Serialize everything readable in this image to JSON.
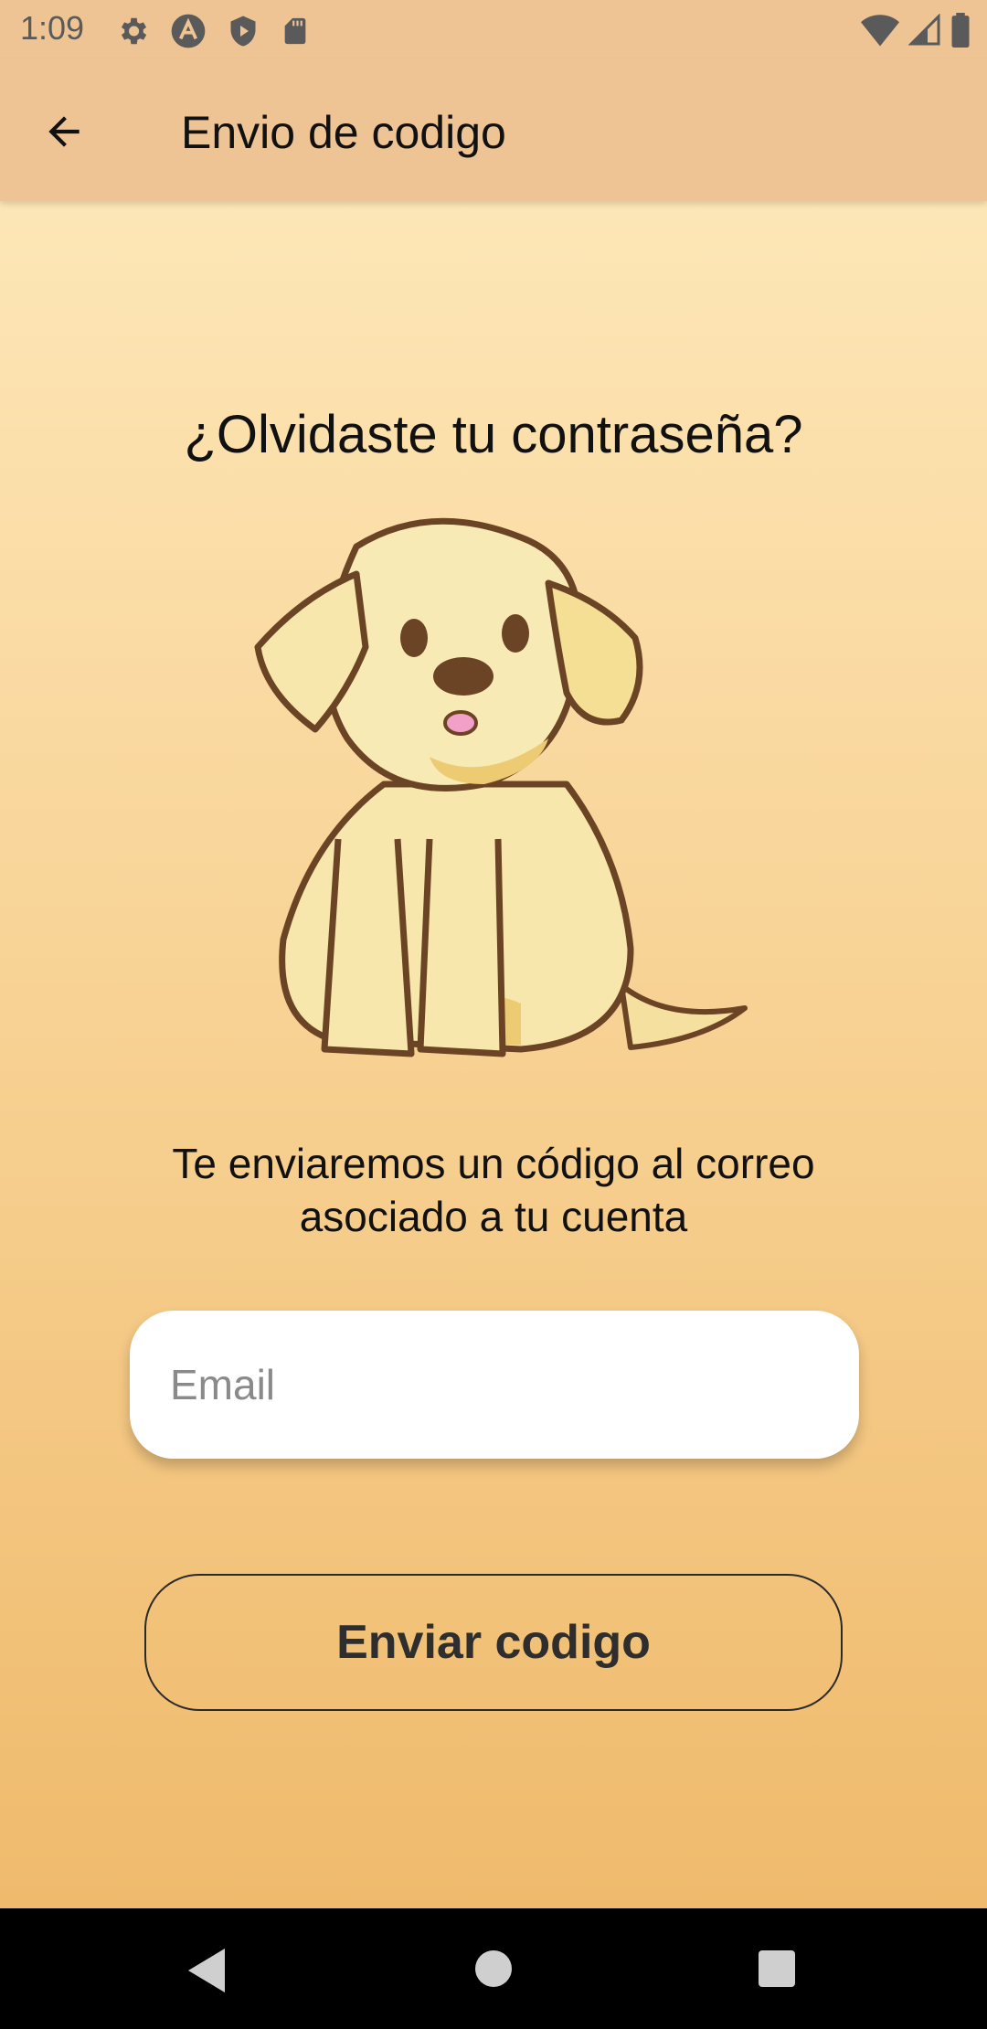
{
  "status_bar": {
    "time": "1:09",
    "left_icons": [
      "gear-icon",
      "autofill-icon",
      "shield-play-icon",
      "sd-card-icon"
    ],
    "right_icons": [
      "wifi-icon",
      "signal-icon",
      "battery-icon"
    ]
  },
  "app_bar": {
    "title": "Envio de codigo",
    "back_icon": "arrow-left-icon"
  },
  "main": {
    "question": "¿Olvidaste tu contraseña?",
    "illustration": "puppy-illustration",
    "description": "Te enviaremos un código al correo asociado a tu cuenta",
    "email": {
      "placeholder": "Email",
      "value": ""
    },
    "send_button_label": "Enviar codigo"
  },
  "nav_bar": {
    "buttons": [
      "back-triangle-icon",
      "home-circle-icon",
      "recents-square-icon"
    ]
  },
  "colors": {
    "app_bar": "#eec494",
    "gradient_top": "#fde6b6",
    "gradient_bottom": "#efba6c",
    "outline": "#2a2a2a"
  }
}
